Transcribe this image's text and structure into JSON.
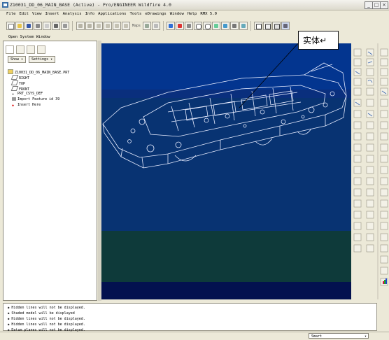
{
  "window": {
    "title": "Z10031_DD_06_MAIN_BASE (Active) - Pro/ENGINEER Wildfire 4.0"
  },
  "menubar": [
    "File",
    "Edit",
    "View",
    "Insert",
    "Analysis",
    "Info",
    "Applications",
    "Tools",
    "eDrawings",
    "Window",
    "Help",
    "RMX 5.0"
  ],
  "toolbar": {
    "open_system_window": "Open System Window",
    "mapkeys_label": "Maps"
  },
  "navigator": {
    "show_label": "Show",
    "settings_label": "Settings",
    "tree": [
      "Z10031_DD_06_MAIN_BASE.PRT",
      "RIGHT",
      "TOP",
      "FRONT",
      "PRT_CSYS_DEF",
      "Import Feature id 39",
      "Insert Here"
    ]
  },
  "annotation": {
    "label": "实体↵"
  },
  "messages": [
    "Hidden lines will not be displayed.",
    "Shaded model will be displayed",
    "Hidden lines will not be displayed.",
    "Hidden lines will not be displayed.",
    "Datum planes will not be displayed."
  ],
  "statusbar": {
    "filter_value": "Smart"
  },
  "colors": {
    "bg_top": "#03358f",
    "bg_mid": "#082a6e",
    "bg_green": "#0e3a3a",
    "bg_bottom": "#03114f",
    "model_line": "#e7ecff",
    "chrome": "#ece9d8"
  }
}
